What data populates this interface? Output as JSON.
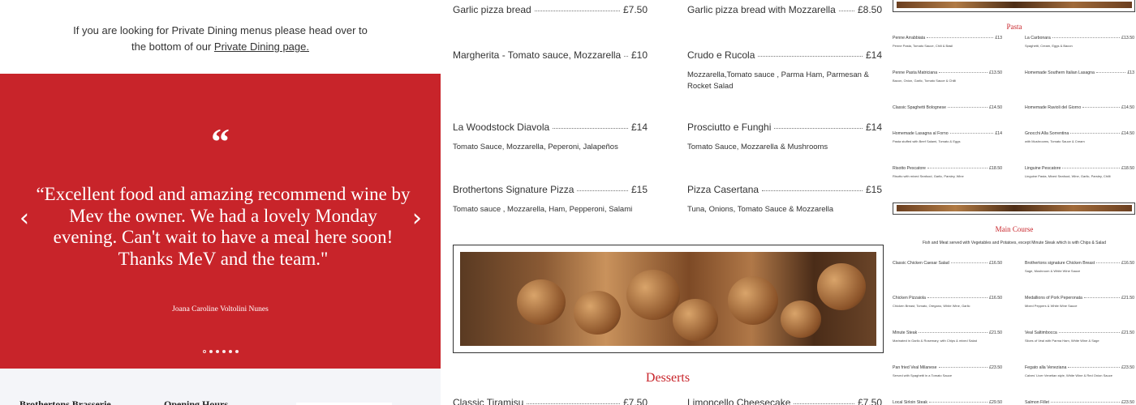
{
  "intro": {
    "line1": "If you are looking for Private Dining menus please head over to",
    "line2_prefix": "the bottom of our ",
    "link": "Private Dining page."
  },
  "testimonial": {
    "quote_mark": "“",
    "text": "“Excellent food and amazing recommend wine by Mev the owner. We had a lovely Monday evening. Can't wait to have a meal here soon! Thanks MeV and the team.\"",
    "author": "Joana Caroline Voltolini Nunes",
    "prev_glyph": "‹",
    "next_glyph": "›",
    "slide_count": 6,
    "active_index": 0
  },
  "footer": {
    "brand": "Brothertons Brasserie",
    "hours": "Opening Hours"
  },
  "pizza_items": [
    {
      "name": "Garlic pizza bread",
      "price": "£7.50",
      "desc": ""
    },
    {
      "name": "Garlic pizza bread with Mozzarella",
      "price": "£8.50",
      "desc": ""
    },
    {
      "name": "Margherita - Tomato sauce, Mozzarella",
      "price": "£10",
      "desc": ""
    },
    {
      "name": "Crudo e Rucola",
      "price": "£14",
      "desc": "Mozzarella,Tomato sauce , Parma Ham, Parmesan & Rocket Salad"
    },
    {
      "name": "La Woodstock Diavola",
      "price": "£14",
      "desc": "Tomato Sauce, Mozzarella, Peperoni, Jalapeños"
    },
    {
      "name": "Prosciutto e Funghi",
      "price": "£14",
      "desc": "Tomato Sauce, Mozzarella & Mushrooms"
    },
    {
      "name": "Brothertons Signature Pizza",
      "price": "£15",
      "desc": "Tomato sauce , Mozzarella, Ham, Pepperoni, Salami"
    },
    {
      "name": "Pizza Casertana",
      "price": "£15",
      "desc": "Tuna, Onions, Tomato Sauce & Mozzarella"
    }
  ],
  "desserts": {
    "title": "Desserts",
    "items": [
      {
        "name": "Classic Tiramisu",
        "price": "£7.50"
      },
      {
        "name": "Limoncello Cheesecake",
        "price": "£7.50"
      }
    ]
  },
  "right_menu": {
    "pasta_title": "Pasta",
    "pasta_items": [
      {
        "name": "Penne Arrabbiata",
        "price": "£13",
        "desc": "Penne Pasta, Tomato Sauce, Chili & Basil"
      },
      {
        "name": "La Carbonara",
        "price": "£13.50",
        "desc": "Spaghetti, Cream, Eggs & Bacon"
      },
      {
        "name": "Penne Pasta Matriciana",
        "price": "£13.50",
        "desc": "Bacon, Onion, Garlic, Tomato Sauce & Chilli"
      },
      {
        "name": "Homemade Southern Italian Lasagna",
        "price": "£13",
        "desc": ""
      },
      {
        "name": "Classic Spaghetti Bolognese",
        "price": "£14.50",
        "desc": ""
      },
      {
        "name": "Homemade Ravioli del Giorno",
        "price": "£14.50",
        "desc": ""
      },
      {
        "name": "Homemade Lasagna al Forno",
        "price": "£14",
        "desc": "Pasta stuffed with Beef Salami, Tomato & Eggs"
      },
      {
        "name": "Gnocchi Alla Sorrentina",
        "price": "£14.50",
        "desc": "with Mushrooms, Tomato Sauce & Cream"
      },
      {
        "name": "Risotto Pescatore",
        "price": "£18.50",
        "desc": "Risotto with mixed Seafood, Garlic, Parsley, Wine"
      },
      {
        "name": "Linguine Pescatore",
        "price": "£18.50",
        "desc": "Linguine Pasta, Mixed Seafood, Wine, Garlic, Parsley, Chilli"
      }
    ],
    "main_title": "Main Course",
    "main_sub": "Fish and Meat served with Vegetables and Potatoes, except Minute Steak which is with Chips & Salad",
    "main_items": [
      {
        "name": "Classic Chicken Caesar Salad",
        "price": "£16.50",
        "desc": ""
      },
      {
        "name": "Brothertons signature Chicken Breast",
        "price": "£16.50",
        "desc": "Sage, Mushroom & White Wine Sauce"
      },
      {
        "name": "Chicken Pizzaiola",
        "price": "£16.50",
        "desc": "Chicken Breast, Tomato, Oregano, White Wine, Garlic"
      },
      {
        "name": "Medallions of Pork Peperonata",
        "price": "£21.50",
        "desc": "Mixed Peppers & White Wine Sauce"
      },
      {
        "name": "Minute Steak",
        "price": "£21.50",
        "desc": "Marinated in Garlic & Rosemary, with Chips & mixed Salad"
      },
      {
        "name": "Veal Saltimbocca",
        "price": "£21.50",
        "desc": "Slices of Veal with Parma Ham, White Wine & Sage"
      },
      {
        "name": "Pan fried Veal Milanese",
        "price": "£23.50",
        "desc": "Served with Spaghetti in a Tomato Sauce"
      },
      {
        "name": "Fegato alla Veneziana",
        "price": "£23.50",
        "desc": "Calves' Liver Venetian style, White Wine & Red Onion Sauce"
      },
      {
        "name": "Local Sirloin Steak",
        "price": "£29.50",
        "desc": ""
      },
      {
        "name": "Salmon Fillet",
        "price": "£23.50",
        "desc": ""
      }
    ]
  }
}
